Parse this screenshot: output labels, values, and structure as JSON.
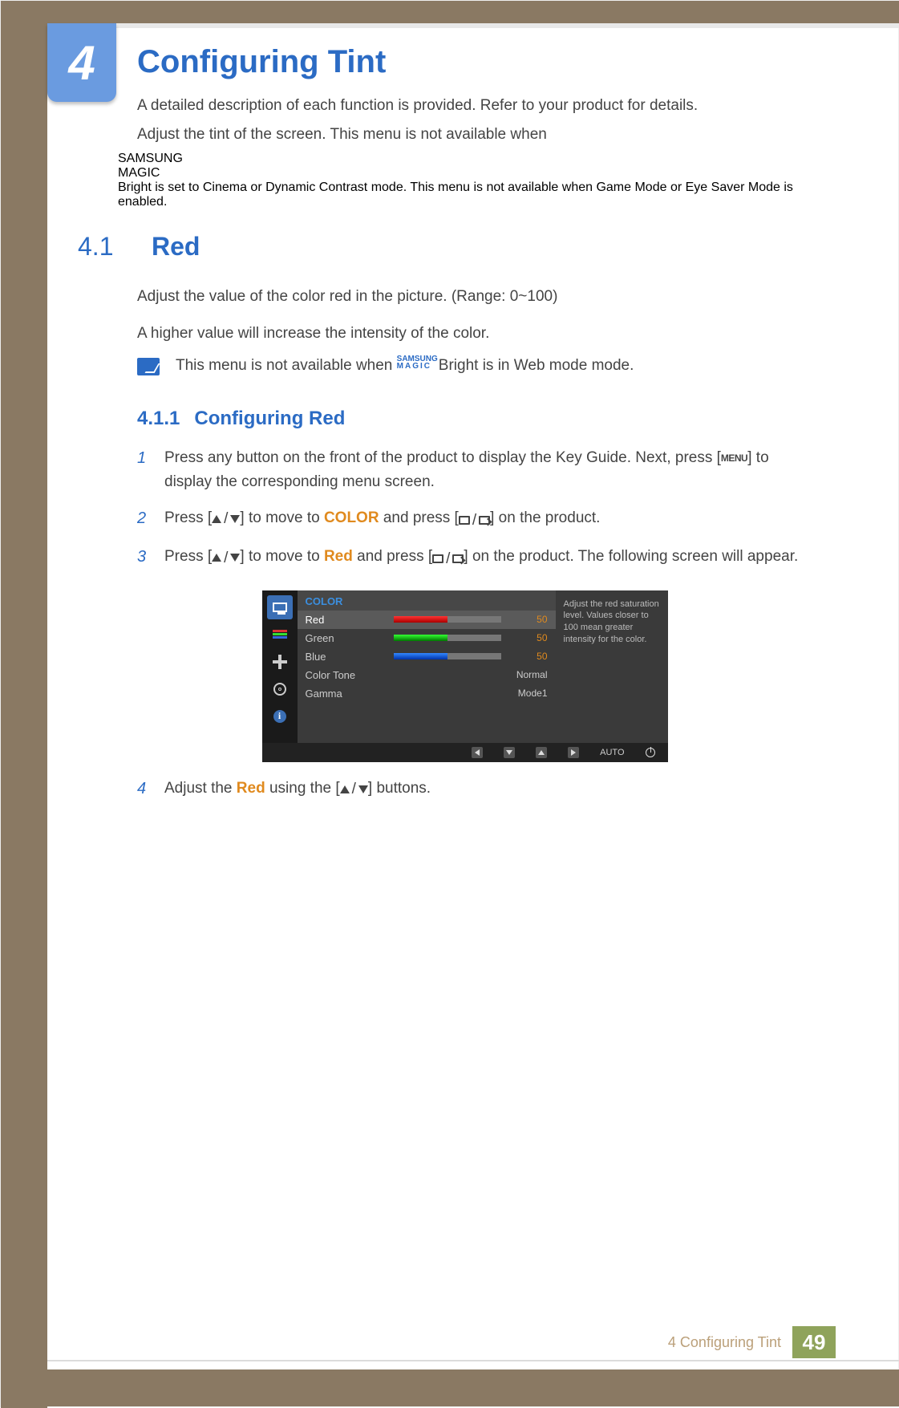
{
  "chapter_badge": "4",
  "title": "Configuring Tint",
  "intro_line1": "A detailed description of each function is provided. Refer to your product for details.",
  "intro_pre": "Adjust the tint of the screen. This menu is not available when ",
  "magic_top": "SAMSUNG",
  "magic_bot": "MAGIC",
  "bright_label": "Bright",
  "intro_mid1": " is set to ",
  "cinema": "Cinema",
  "intro_mid2": " or ",
  "dyn": "Dynamic Contrast",
  "intro_mid3": " mode. This menu is not available when ",
  "game": "Game Mode",
  "intro_mid4": " or ",
  "eye": "Eye Saver Mode",
  "intro_end": " is enabled.",
  "section": {
    "num": "4.1",
    "title": "Red"
  },
  "red_desc1": "Adjust the value of the color red in the picture. (Range: 0~100)",
  "red_desc2": "A higher value will increase the intensity of the color.",
  "note_pre": "This menu is not available when ",
  "note_mid": " is in ",
  "webmode": "Web mode",
  "note_end": " mode.",
  "subsection": {
    "num": "4.1.1",
    "title": "Configuring Red"
  },
  "steps": {
    "s1a": "Press any button on the front of the product to display the Key Guide. Next, press [",
    "menu": "MENU",
    "s1b": "] to display the corresponding menu screen.",
    "s2a": "Press [",
    "s2b": "] to move to ",
    "color_word": "COLOR",
    "s2c": " and press [",
    "s2d": "] on the product.",
    "s3a": "Press [",
    "s3b": "] to move to ",
    "red_word": "Red",
    "s3c": " and press [",
    "s3d": "] on the product. The following screen will appear.",
    "s4a": "Adjust the ",
    "s4b": " using the [",
    "s4c": "] buttons."
  },
  "osd": {
    "header": "COLOR",
    "rows": {
      "red": {
        "label": "Red",
        "value": "50"
      },
      "green": {
        "label": "Green",
        "value": "50"
      },
      "blue": {
        "label": "Blue",
        "value": "50"
      },
      "tone": {
        "label": "Color Tone",
        "value": "Normal"
      },
      "gamma": {
        "label": "Gamma",
        "value": "Mode1"
      }
    },
    "help": "Adjust the red saturation level. Values closer to 100 mean greater intensity for the color.",
    "auto": "AUTO",
    "info_i": "i"
  },
  "footer": {
    "chapter": "4 Configuring Tint",
    "page": "49"
  }
}
